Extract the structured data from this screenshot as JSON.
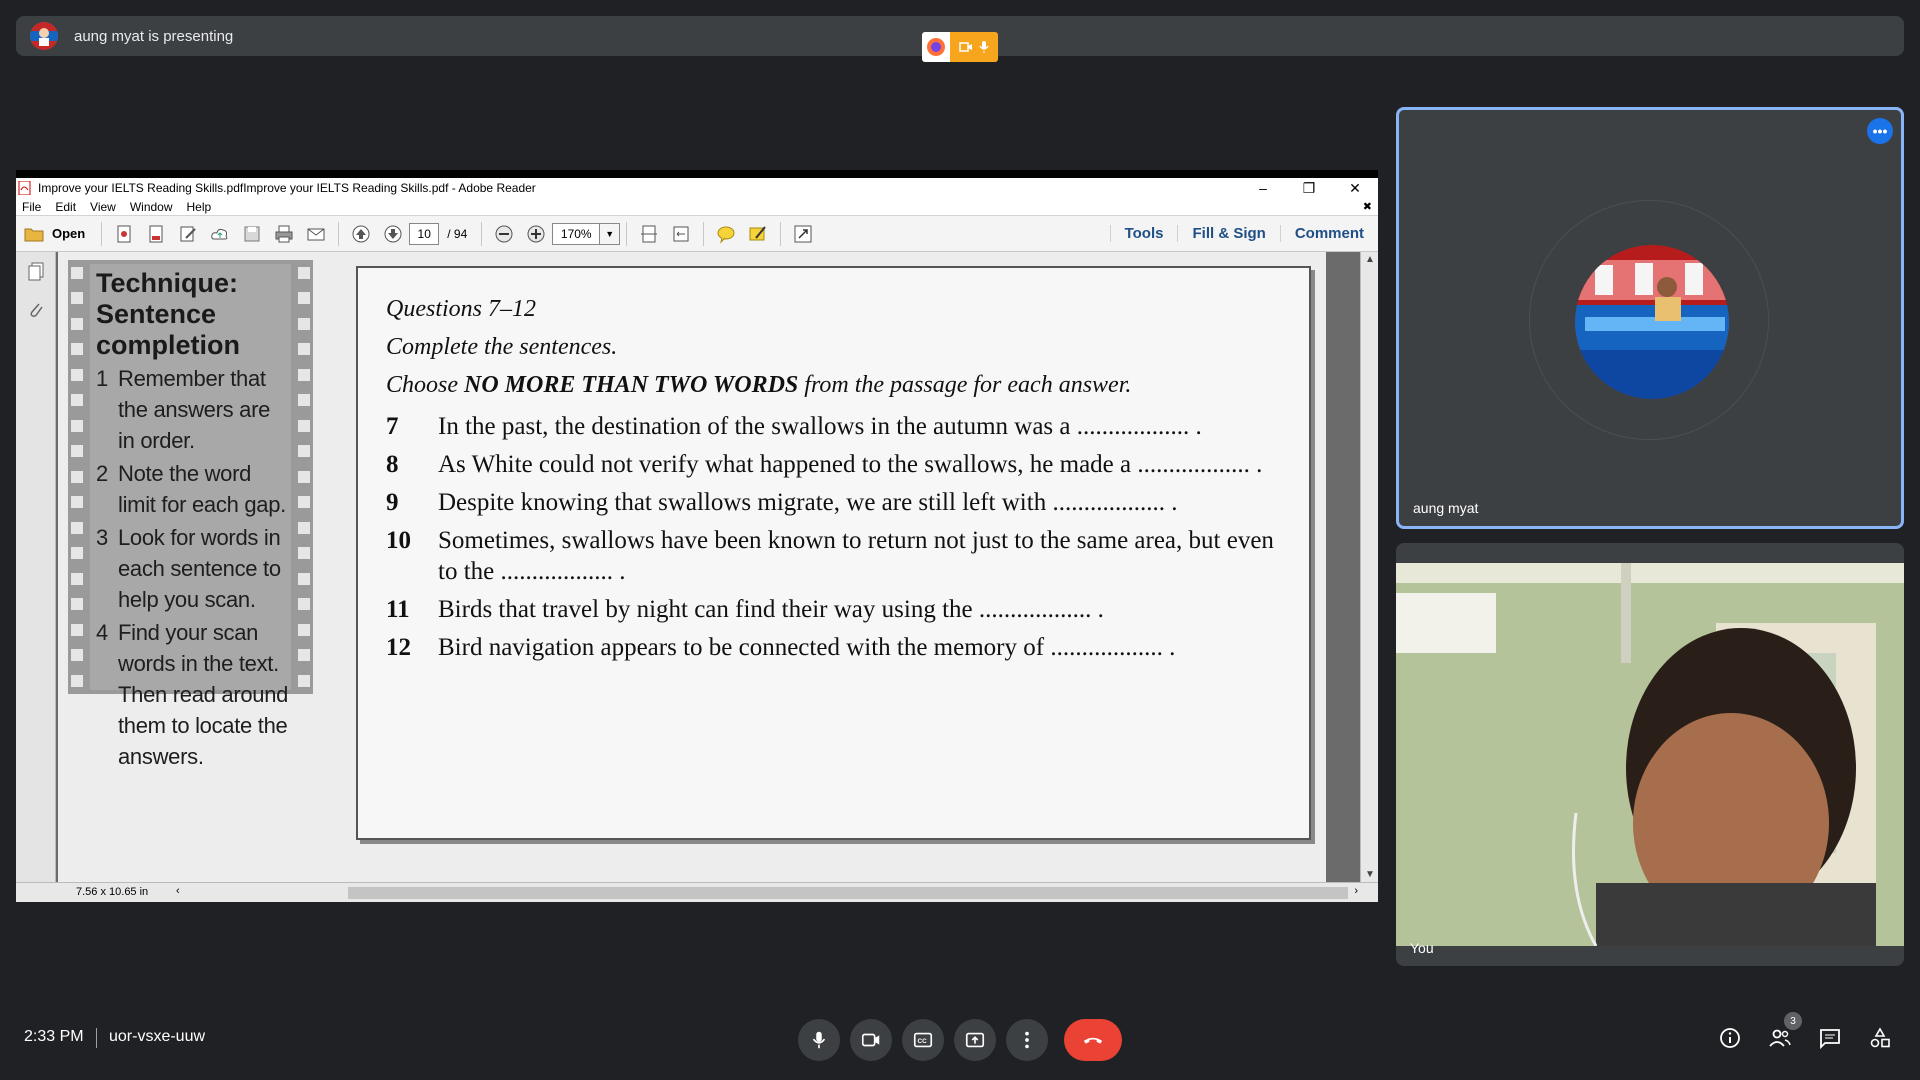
{
  "banner": {
    "presenting_text": "aung myat is presenting"
  },
  "window": {
    "title": "Improve your IELTS Reading Skills.pdfImprove your IELTS Reading Skills.pdf - Adobe Reader",
    "menu": [
      "File",
      "Edit",
      "View",
      "Window",
      "Help"
    ],
    "open_label": "Open",
    "page_current": "10",
    "page_total": "/ 94",
    "zoom": "170%",
    "right_tabs": [
      "Tools",
      "Fill & Sign",
      "Comment"
    ],
    "page_size": "7.56 x 10.65 in"
  },
  "technique": {
    "title": "Technique: Sentence completion",
    "items": [
      {
        "n": "1",
        "text": "Remember that the answers are in order."
      },
      {
        "n": "2",
        "text": "Note the word limit for each gap."
      },
      {
        "n": "3",
        "text": "Look for words in each sentence to help you scan."
      },
      {
        "n": "4",
        "text": "Find your scan words in the text. Then read around them to locate the answers."
      }
    ]
  },
  "questions": {
    "heading": "Questions 7–12",
    "sub": "Complete the sentences.",
    "instr_pre": "Choose ",
    "instr_bold": "NO MORE THAN TWO WORDS",
    "instr_post": " from the passage for each answer.",
    "items": [
      {
        "n": "7",
        "text": "In the past, the destination of the swallows in the autumn was a .................. ."
      },
      {
        "n": "8",
        "text": "As White could not verify what happened to the swallows, he made a .................. ."
      },
      {
        "n": "9",
        "text": "Despite knowing that swallows migrate, we are still left with .................. ."
      },
      {
        "n": "10",
        "text": "Sometimes, swallows have been known to return not just to the same area, but even to the .................. ."
      },
      {
        "n": "11",
        "text": "Birds that travel by night can find their way using the .................. ."
      },
      {
        "n": "12",
        "text": "Bird navigation appears to be connected with the memory of .................. ."
      }
    ]
  },
  "participants": {
    "presenter_name": "aung myat",
    "self_name": "You"
  },
  "footer": {
    "time": "2:33 PM",
    "meeting_code": "uor-vsxe-uuw",
    "participant_count": "3"
  },
  "colors": {
    "accent": "#8ab4f8",
    "end_call": "#ea4335",
    "share_tray": "#f7a51c"
  }
}
